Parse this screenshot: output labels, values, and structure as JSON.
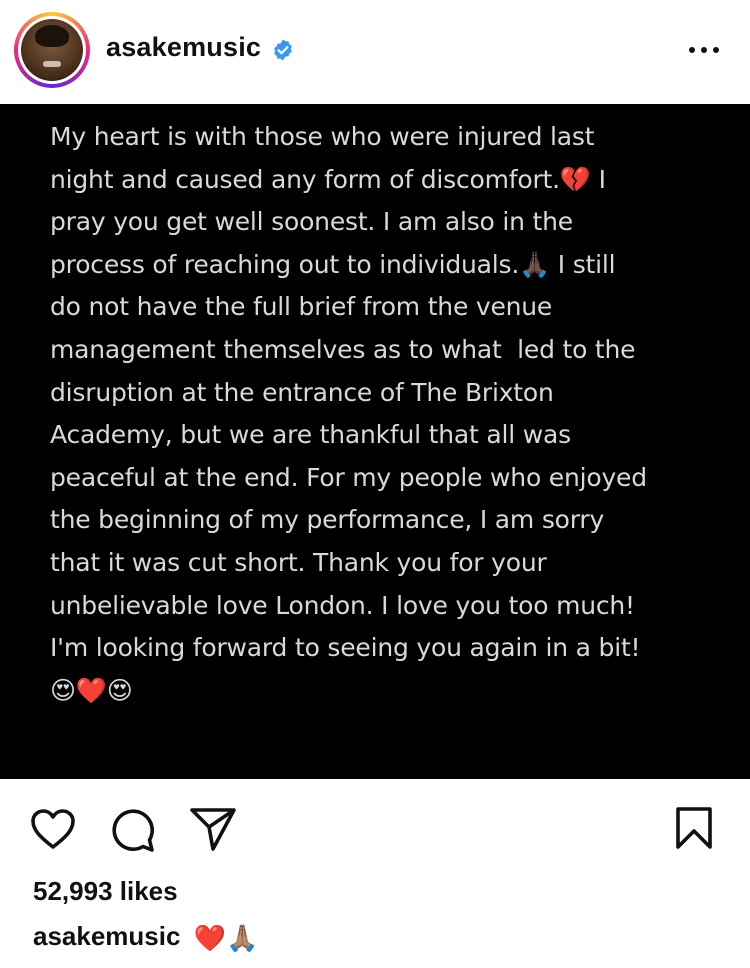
{
  "header": {
    "username": "asakemusic",
    "verified": true,
    "avatar_icon": "profile-photo",
    "more_icon": "more-horizontal-icon"
  },
  "post": {
    "background": "#000000",
    "text_color": "#d9d9d9",
    "text": "My heart is with those who were injured last\nnight and caused any form of discomfort.💔 I\npray you get well soonest. I am also in the\nprocess of reaching out to individuals.🙏🏿 I still\ndo not have the full brief from the venue\nmanagement themselves as to what  led to the\ndisruption at the entrance of The Brixton\nAcademy, but we are thankful that all was\npeaceful at the end. For my people who enjoyed\nthe beginning of my performance, I am sorry\nthat it was cut short. Thank you for your\nunbelievable love London. I love you too much!\nI'm looking forward to seeing you again in a bit!\n😍❤️😍"
  },
  "actions": {
    "like_icon": "heart-icon",
    "comment_icon": "comment-icon",
    "share_icon": "send-icon",
    "save_icon": "bookmark-icon"
  },
  "likes": "52,993 likes",
  "caption": {
    "user": "asakemusic",
    "text": "❤️🙏🏽"
  },
  "colors": {
    "verified_blue": "#3897f0",
    "emoji_red": "#d0212b",
    "emoji_skin": "#c68642"
  }
}
